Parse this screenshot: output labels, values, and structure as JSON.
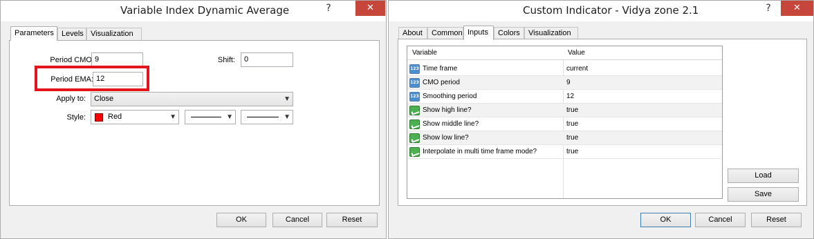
{
  "dialog1": {
    "title": "Variable Index Dynamic Average",
    "help": "?",
    "close": "✕",
    "tabs": [
      "Parameters",
      "Levels",
      "Visualization"
    ],
    "fields": {
      "period_cmo_label": "Period CMO:",
      "period_cmo_value": "9",
      "shift_label": "Shift:",
      "shift_value": "0",
      "period_ema_label": "Period EMA:",
      "period_ema_value": "12",
      "apply_to_label": "Apply to:",
      "apply_to_value": "Close",
      "style_label": "Style:",
      "color_value": "Red"
    },
    "buttons": {
      "ok": "OK",
      "cancel": "Cancel",
      "reset": "Reset"
    }
  },
  "dialog2": {
    "title": "Custom Indicator - Vidya zone 2.1",
    "help": "?",
    "close": "✕",
    "tabs": [
      "About",
      "Common",
      "Inputs",
      "Colors",
      "Visualization"
    ],
    "table": {
      "headers": [
        "Variable",
        "Value"
      ],
      "rows": [
        {
          "name": "Time frame",
          "value": "current",
          "icon": "123"
        },
        {
          "name": "CMO period",
          "value": "9",
          "icon": "123"
        },
        {
          "name": "Smoothing period",
          "value": "12",
          "icon": "123"
        },
        {
          "name": "Show high line?",
          "value": "true",
          "icon": "bool"
        },
        {
          "name": "Show middle line?",
          "value": "true",
          "icon": "bool"
        },
        {
          "name": "Show low line?",
          "value": "true",
          "icon": "bool"
        },
        {
          "name": "Interpolate in multi time frame mode?",
          "value": "true",
          "icon": "bool"
        }
      ]
    },
    "side_buttons": {
      "load": "Load",
      "save": "Save"
    },
    "buttons": {
      "ok": "OK",
      "cancel": "Cancel",
      "reset": "Reset"
    }
  },
  "colors": {
    "highlight": "#e3141b",
    "close_button": "#c7463c",
    "swatch_red": "#ff0000"
  }
}
